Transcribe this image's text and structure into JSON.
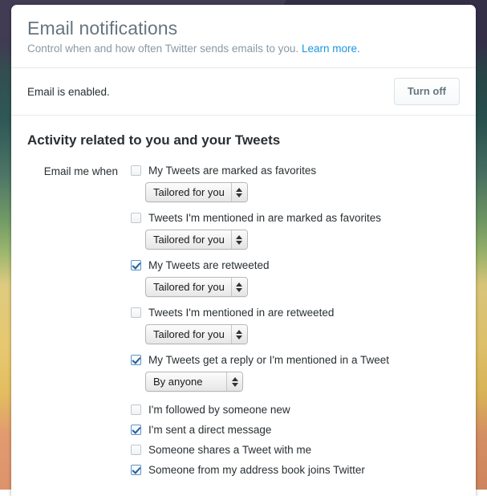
{
  "header": {
    "title": "Email notifications",
    "subtitle_text": "Control when and how often Twitter sends emails to you.",
    "learn_more_label": "Learn more."
  },
  "status": {
    "text": "Email is enabled.",
    "turn_off_label": "Turn off"
  },
  "section": {
    "title": "Activity related to you and your Tweets",
    "field_label": "Email me when"
  },
  "options_with_select": [
    {
      "label": "My Tweets are marked as favorites",
      "checked": false,
      "select_value": "Tailored for you"
    },
    {
      "label": "Tweets I'm mentioned in are marked as favorites",
      "checked": false,
      "select_value": "Tailored for you"
    },
    {
      "label": "My Tweets are retweeted",
      "checked": true,
      "select_value": "Tailored for you"
    },
    {
      "label": "Tweets I'm mentioned in are retweeted",
      "checked": false,
      "select_value": "Tailored for you"
    },
    {
      "label": "My Tweets get a reply or I'm mentioned in a Tweet",
      "checked": true,
      "select_value": "By anyone"
    }
  ],
  "options_plain": [
    {
      "label": "I'm followed by someone new",
      "checked": false
    },
    {
      "label": "I'm sent a direct message",
      "checked": true
    },
    {
      "label": "Someone shares a Tweet with me",
      "checked": false
    },
    {
      "label": "Someone from my address book joins Twitter",
      "checked": true
    }
  ],
  "colors": {
    "link": "#1b95e0",
    "title": "#66757f",
    "text": "#292f33",
    "muted": "#8899a6",
    "checkbox_checked": "#1f5f9e",
    "border": "#e8e8e8"
  }
}
